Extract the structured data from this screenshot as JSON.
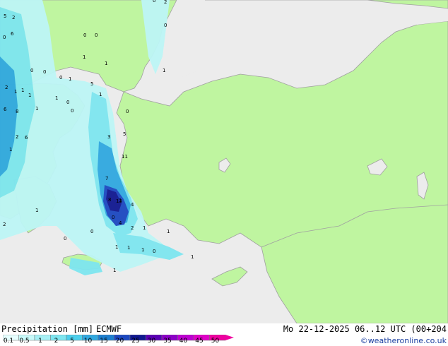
{
  "map": {
    "colors": {
      "sea": "#ececec",
      "land": "#bff5a0",
      "border": "#a0a0a0",
      "precip_light": "#bdf6f6",
      "precip_med": "#7ee6f0",
      "precip_heavy": "#30a8e0",
      "precip_strong": "#1c48c0",
      "precip_max": "#101890"
    },
    "labels": [
      "5",
      "2",
      "0",
      "6",
      "0",
      "0",
      "2",
      "0",
      "0",
      "1",
      "1",
      "1",
      "0",
      "1",
      "2",
      "1",
      "1",
      "0",
      "1",
      "5",
      "1",
      "0",
      "1",
      "0",
      "0",
      "6",
      "8",
      "1",
      "2",
      "6",
      "1",
      "11",
      "5",
      "3",
      "0",
      "7",
      "8",
      "1",
      "4",
      "13",
      "0",
      "4",
      "2",
      "1",
      "1",
      "1",
      "1",
      "1",
      "0",
      "1",
      "0",
      "1",
      "0",
      "2",
      "1"
    ]
  },
  "legend": {
    "title": "Precipitation [mm]",
    "model": "ECMWF",
    "datetime": "Mo 22-12-2025 06..12 UTC (00+204",
    "credit": "©weatheronline.co.uk",
    "scale": {
      "ticks": [
        "0.1",
        "0.5",
        "1",
        "2",
        "5",
        "10",
        "15",
        "20",
        "25",
        "30",
        "35",
        "40",
        "45",
        "50"
      ],
      "colors": [
        "#e6ffff",
        "#c8fafa",
        "#a6f0f5",
        "#7ee6f0",
        "#4ccfec",
        "#30a8e0",
        "#1c7fd0",
        "#1c48c0",
        "#101890",
        "#5a00b4",
        "#8c00c8",
        "#be00d2",
        "#e000c8",
        "#f000a0"
      ]
    }
  }
}
